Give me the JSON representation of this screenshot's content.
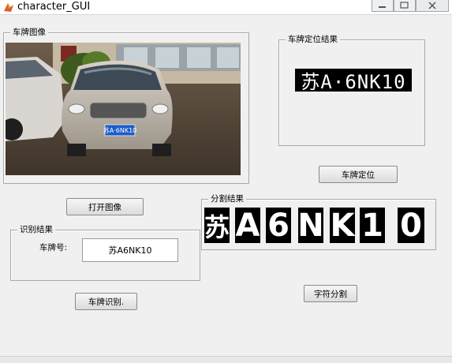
{
  "window": {
    "title": "character_GUI"
  },
  "panels": {
    "image": "车牌图像",
    "locate": "车牌定位结果",
    "segment": "分割结果",
    "recognize": "识别结果"
  },
  "buttons": {
    "open": "打开图像",
    "locate": "车牌定位",
    "segment": "字符分割",
    "recognize": "车牌识别."
  },
  "recognize": {
    "label": "车牌号:",
    "value": "苏A6NK10"
  },
  "plate_text": "苏A·6NK10",
  "photo_plate_text": "苏A·6NK10",
  "segments": [
    "苏",
    "A",
    "6",
    "N",
    "K",
    "1",
    "0"
  ]
}
